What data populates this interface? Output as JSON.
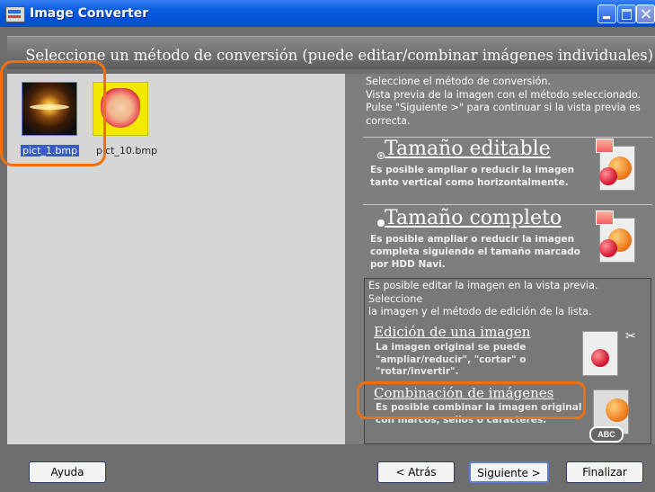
{
  "window": {
    "title": "Image Converter"
  },
  "header": {
    "text": "Seleccione un método de conversión (puede editar/combinar imágenes individuales)"
  },
  "files": [
    {
      "name": "pict_1.bmp",
      "selected": true
    },
    {
      "name": "pict_10.bmp",
      "selected": false
    }
  ],
  "instructions": [
    "Seleccione el método de conversión.",
    "Vista previa de la imagen con el método seleccionado.",
    "Pulse \"Siguiente >\" para continuar si la vista previa es",
    "correcta."
  ],
  "options": {
    "editable": {
      "title": "Tamaño editable",
      "desc": [
        "Es posible ampliar o reducir la imagen",
        "tanto vertical como horizontalmente."
      ],
      "selected": true
    },
    "full": {
      "title": "Tamaño completo",
      "desc": [
        "Es posible ampliar o reducir la imagen",
        "completa siguiendo el tamaño marcado",
        "por HDD Navi."
      ],
      "selected": false
    }
  },
  "edit_section": {
    "info": [
      "Es posible editar la imagen en la vista previa. Seleccione",
      "la imagen y el método de edición de la lista."
    ],
    "single": {
      "title": "Edición de una imagen",
      "desc": [
        "La imagen original se puede",
        "\"ampliar/reducir\", \"cortar\" o",
        "\"rotar/invertir\"."
      ]
    },
    "combine": {
      "title": "Combinación de imágenes",
      "desc": [
        "Es posible combinar la imagen original",
        "con marcos, sellos o caracteres."
      ],
      "badge": "ABC"
    }
  },
  "buttons": {
    "help": "Ayuda",
    "back": "< Atrás",
    "next": "Siguiente >",
    "finish": "Finalizar"
  },
  "colors": {
    "highlight": "#f07010",
    "titlebar": "#0350d8",
    "panel_left": "#d6d6d6",
    "panel_right": "#7e7e7e"
  }
}
